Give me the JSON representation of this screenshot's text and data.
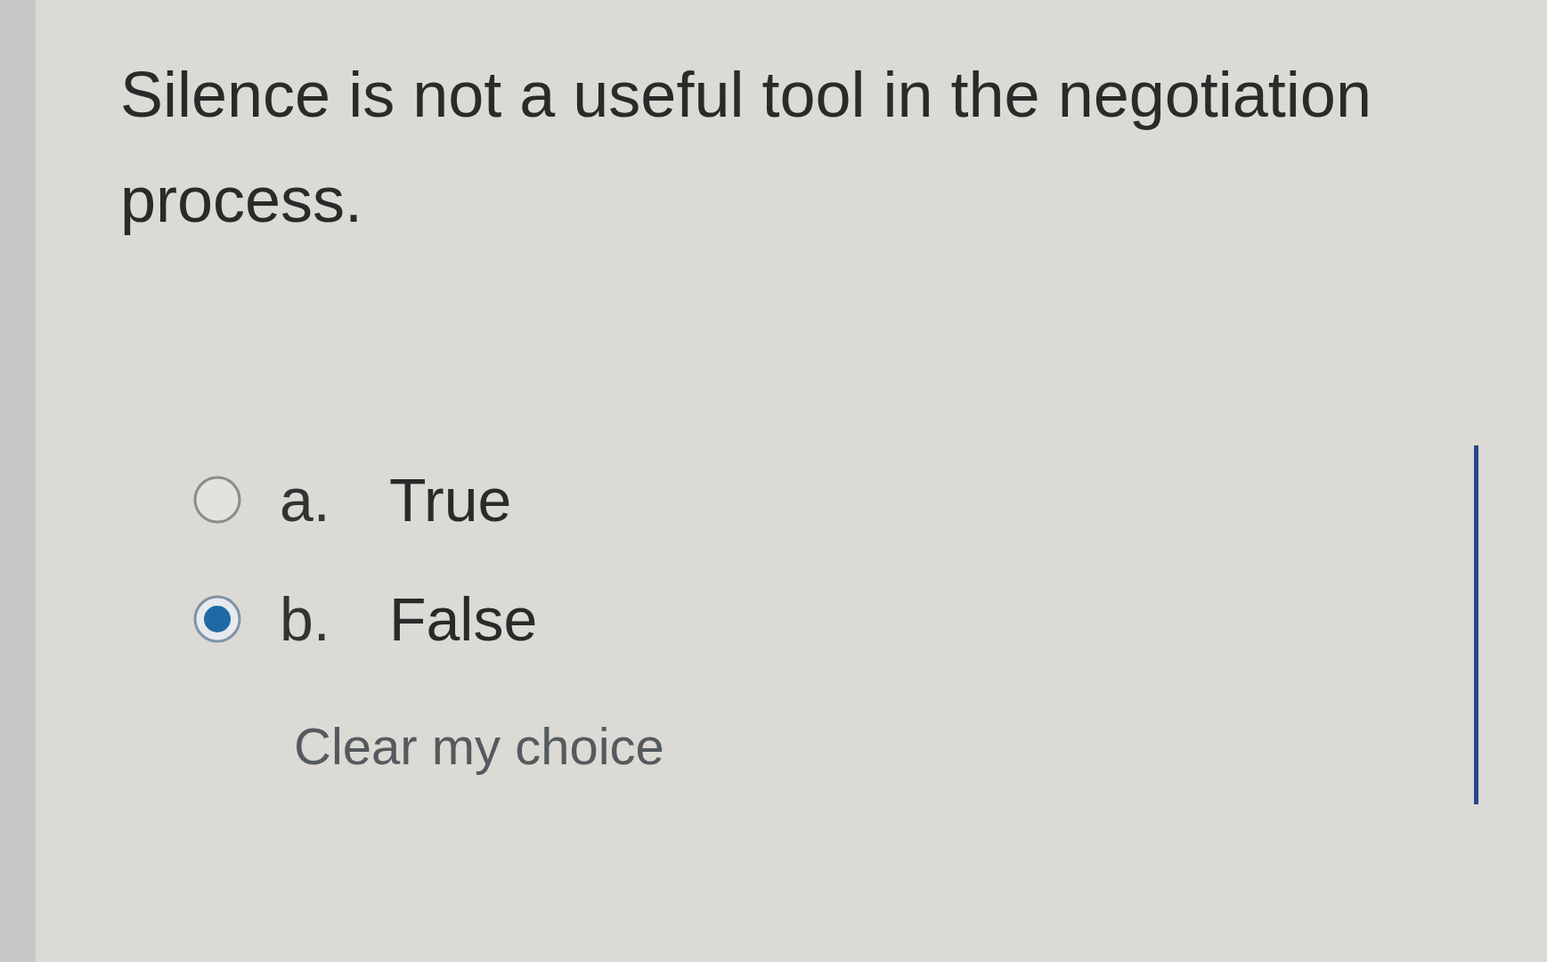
{
  "question": {
    "text": "Silence is not a useful tool in the negotiation process."
  },
  "options": [
    {
      "letter": "a.",
      "label": "True",
      "selected": false
    },
    {
      "letter": "b.",
      "label": "False",
      "selected": true
    }
  ],
  "clear_link": {
    "label": "Clear my choice"
  }
}
